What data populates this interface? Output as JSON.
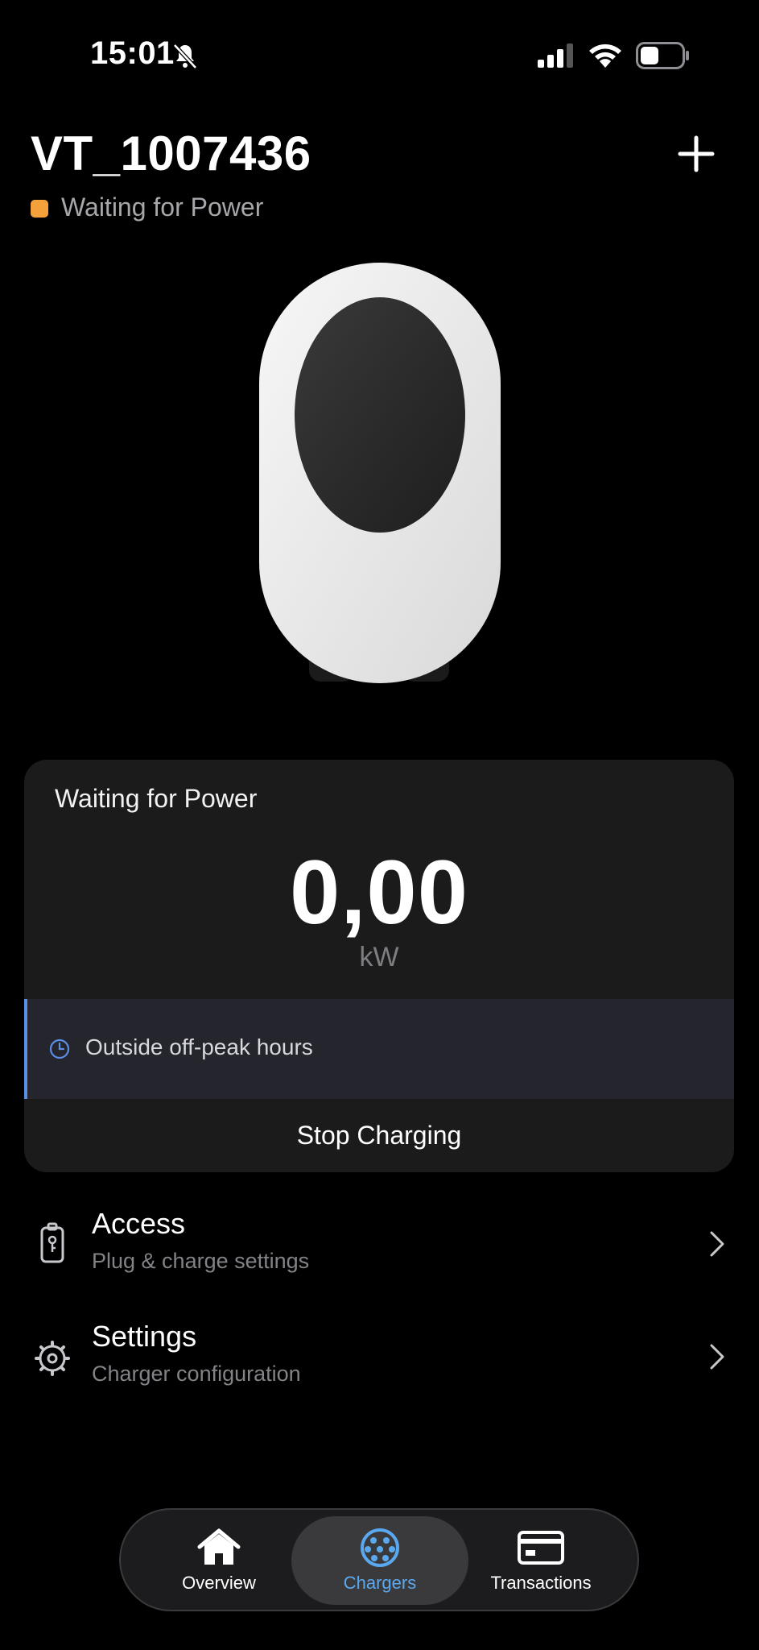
{
  "status_bar": {
    "time": "15:01"
  },
  "header": {
    "charger_name": "VT_1007436",
    "status": "Waiting for Power",
    "status_color": "#f4a13c"
  },
  "card": {
    "title": "Waiting for Power",
    "power_value": "0,00",
    "power_unit": "kW",
    "notice": "Outside off-peak hours",
    "notice_icon": "clock-icon",
    "stop_label": "Stop Charging"
  },
  "menu": [
    {
      "title": "Access",
      "subtitle": "Plug & charge settings",
      "icon": "key-card-icon"
    },
    {
      "title": "Settings",
      "subtitle": "Charger configuration",
      "icon": "gear-icon"
    }
  ],
  "nav": {
    "items": [
      {
        "label": "Overview",
        "icon": "home-icon",
        "active": false
      },
      {
        "label": "Chargers",
        "icon": "charger-plug-icon",
        "active": true
      },
      {
        "label": "Transactions",
        "icon": "card-icon",
        "active": false
      }
    ],
    "accent": "#5aa9f0"
  }
}
